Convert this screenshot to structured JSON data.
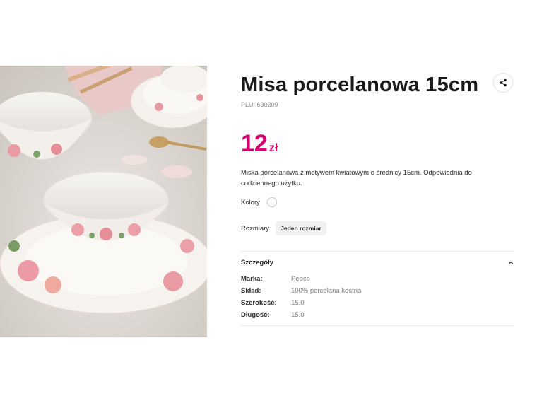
{
  "product": {
    "title": "Misa porcelanowa 15cm",
    "plu": "PLU: 630209",
    "price_amount": "12",
    "price_currency": "zł",
    "description": "Miska porcelanowa z motywem kwiatowym o średnicy 15cm. Odpowiednia do codziennego użytku.",
    "image_alt": "Porcelanowa misa z motywem kwiatowym na stole"
  },
  "options": {
    "colors_label": "Kolory",
    "sizes_label": "Rozmiary",
    "size_value": "Jeden rozmiar"
  },
  "details": {
    "title": "Szczegóły",
    "rows": [
      {
        "key": "Marka:",
        "value": "Pepco"
      },
      {
        "key": "Skład:",
        "value": "100% porcelana kostna"
      },
      {
        "key": "Szerokość:",
        "value": "15.0"
      },
      {
        "key": "Długość:",
        "value": "15.0"
      }
    ]
  },
  "icons": {
    "share": "share-icon",
    "chevron": "chevron-up-icon"
  },
  "colors": {
    "price": "#d4006f"
  }
}
